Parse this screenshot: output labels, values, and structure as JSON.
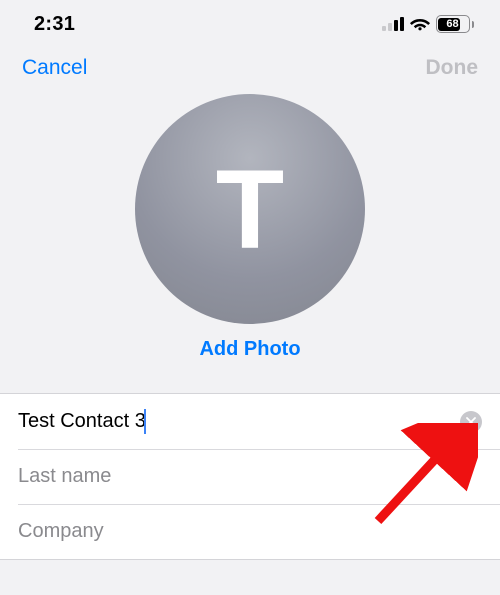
{
  "status": {
    "time": "2:31",
    "battery_pct": "68"
  },
  "nav": {
    "cancel": "Cancel",
    "done": "Done"
  },
  "avatar": {
    "initial": "T",
    "add_photo": "Add Photo"
  },
  "form": {
    "first_name_value": "Test Contact 3",
    "last_name_placeholder": "Last name",
    "company_placeholder": "Company"
  }
}
